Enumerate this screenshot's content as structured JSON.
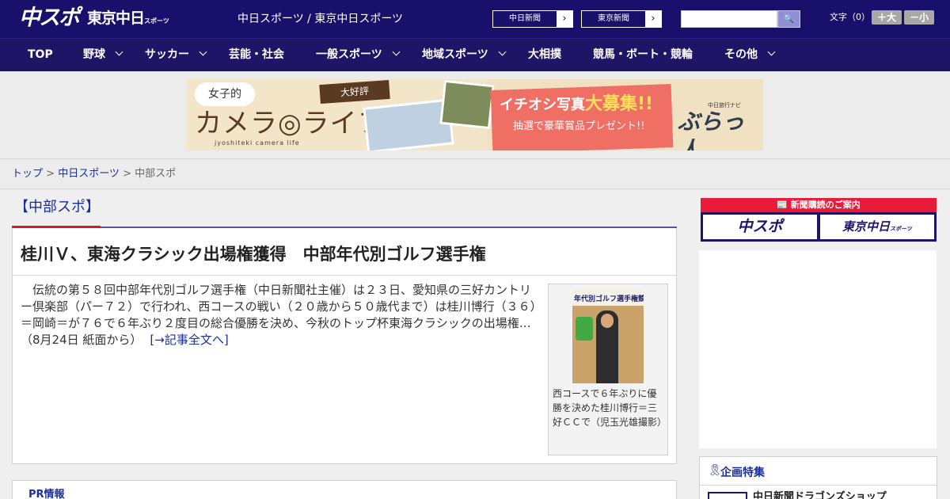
{
  "header": {
    "logo_chuspo": "中スポ",
    "logo_tokyo": "東京中日",
    "logo_tokyo_small": "スポーツ",
    "site_link": "中日スポーツ / 東京中日スポーツ",
    "ext_links": [
      "中日新聞",
      "東京新聞"
    ],
    "search_placeholder": "",
    "fontsize_label": "文字（0）",
    "fontsize_plus": "＋大",
    "fontsize_minus": "－小"
  },
  "nav": {
    "items": [
      "TOP",
      "野球",
      "サッカー",
      "芸能・社会",
      "一般スポーツ",
      "地域スポーツ",
      "大相撲",
      "競馬・ボート・競輪",
      "その他"
    ]
  },
  "banner": {
    "bubble": "女子的",
    "title": "カメラ◎ライフ",
    "sub": "jyoshiteki camera life",
    "popular": "大好評",
    "headline_pre": "イチオシ写真",
    "headline_em": "大募集!!",
    "sub_headline": "抽選で豪華賞品プレゼント!!",
    "brand_small": "中日旅行ナビ",
    "brand": "ぶらっ人"
  },
  "breadcrumb": {
    "top": "トップ",
    "sep1": " > ",
    "section": "中日スポーツ",
    "sep2": " > ",
    "current": "中部スポ"
  },
  "category": {
    "heading": "【中部スポ】"
  },
  "article": {
    "title": "桂川Ｖ、東海クラシック出場権獲得　中部年代別ゴルフ選手権",
    "body": "伝統の第５８回中部年代別ゴルフ選手権（中日新聞社主催）は２３日、愛知県の三好カントリー倶楽部（パー７２）で行われ、西コースの戦い（２０歳から５０歳代まで）は桂川博行（３６）＝岡崎＝が７６で６年ぶり２度目の総合優勝を決め、今秋のトップ杯東海クラシックの出場権…（8月24日 紙面から）",
    "read_more": "[→記事全文へ]",
    "photo_board_text": "年代別ゴルフ選手権競技",
    "photo_caption": "西コースで６年ぶりに優勝を決めた桂川博行＝三好ＣＣで（児玉光雄撮影）"
  },
  "pr": {
    "title": "PR情報"
  },
  "sidebar": {
    "subscribe_heading": "新聞購読のご案内",
    "subscribe_buttons": [
      "中スポ",
      "東京中日"
    ],
    "subscribe_small": "スポーツ",
    "feature_title": "企画特集",
    "feature_item": "中日新聞ドラゴンズショップ"
  },
  "colors": {
    "header_bg": "#19106b",
    "nav_bg": "#1f1566",
    "link": "#1a2f9a",
    "accent_red": "#d21b2c",
    "subscribe_red": "#e81b3a"
  }
}
